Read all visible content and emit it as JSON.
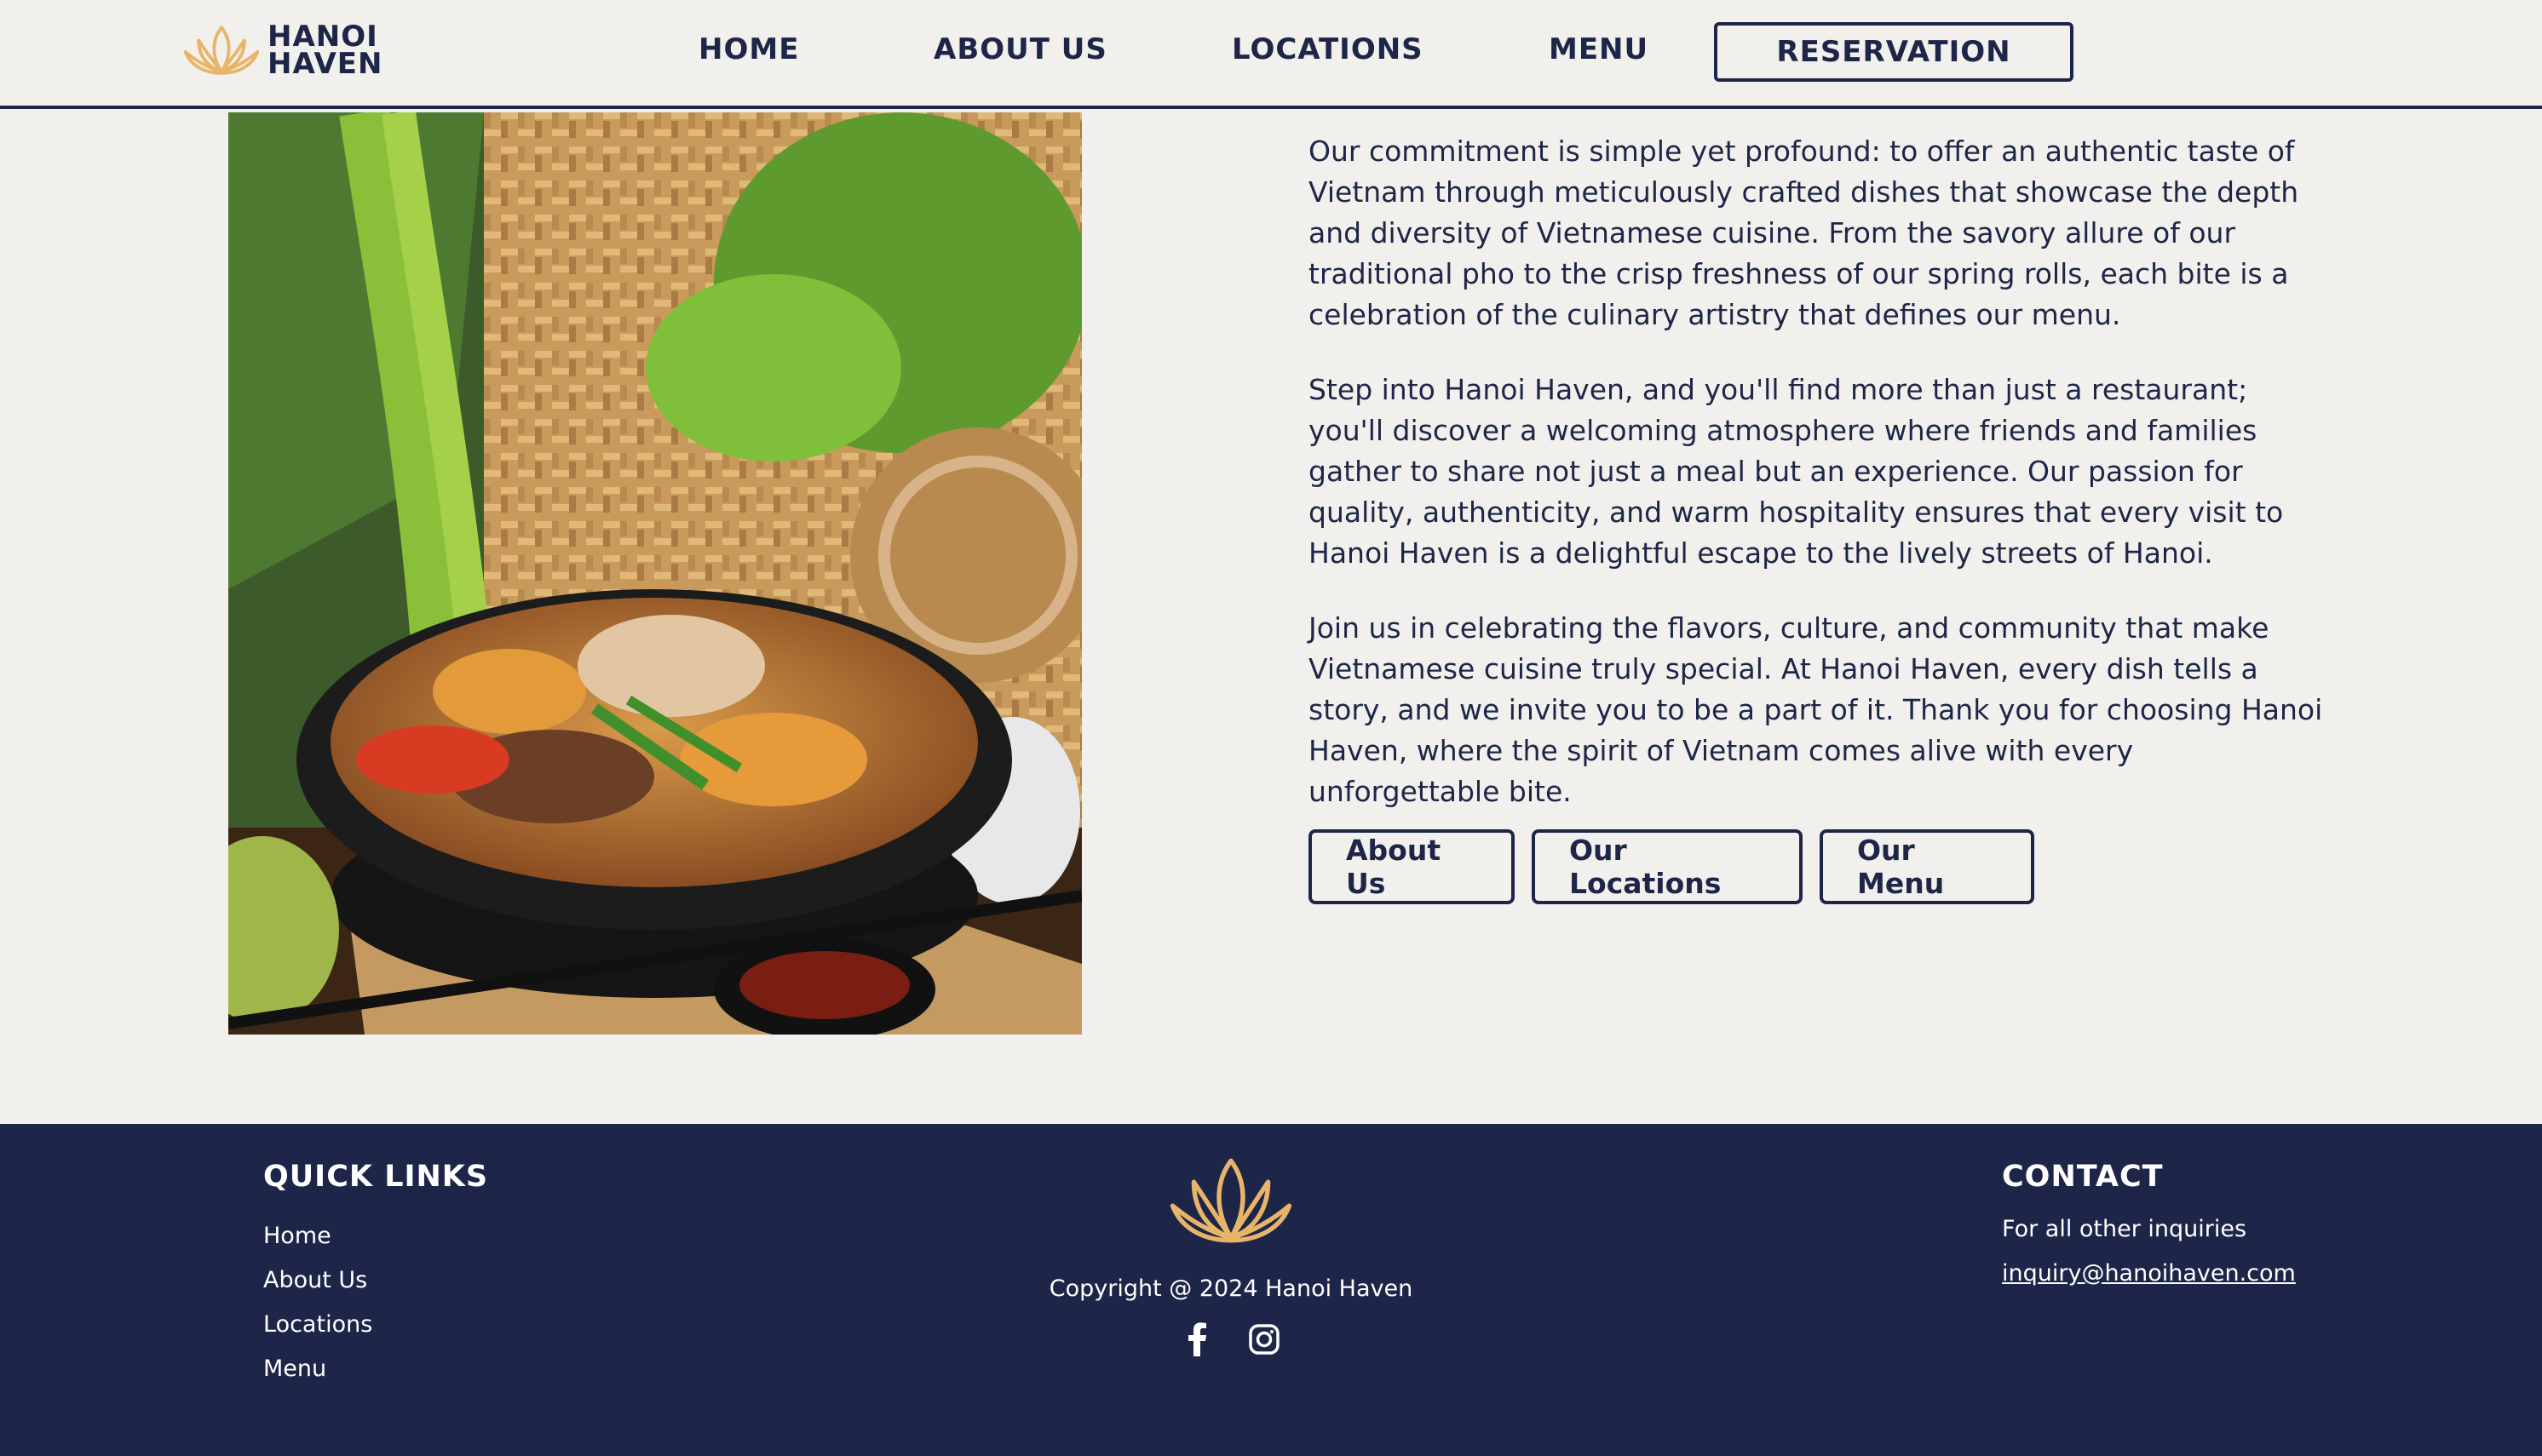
{
  "brand": {
    "name_line1": "HANOI",
    "name_line2": "HAVEN",
    "accent": "#e8b46a",
    "navy": "#1d2648"
  },
  "nav": {
    "items": [
      {
        "label": "HOME"
      },
      {
        "label": "ABOUT US"
      },
      {
        "label": "LOCATIONS"
      },
      {
        "label": "MENU"
      }
    ],
    "reservation_label": "RESERVATION"
  },
  "hero_image": {
    "icon": "food-photo"
  },
  "content": {
    "paragraphs": [
      "Our commitment is simple yet profound: to offer an authentic taste of Vietnam through meticulously crafted dishes that showcase the depth and diversity of Vietnamese cuisine. From the savory allure of our traditional pho to the crisp freshness of our spring rolls, each bite is a celebration of the culinary artistry that defines our menu.",
      "Step into Hanoi Haven, and you'll find more than just a restaurant; you'll discover a welcoming atmosphere where friends and families gather to share not just a meal but an experience. Our passion for quality, authenticity, and warm hospitality ensures that every visit to Hanoi Haven is a delightful escape to the lively streets of Hanoi.",
      "Join us in celebrating the flavors, culture, and community that make Vietnamese cuisine truly special. At Hanoi Haven, every dish tells a story, and we invite you to be a part of it. Thank you for choosing Hanoi Haven, where the spirit of Vietnam comes alive with every unforgettable bite."
    ],
    "buttons": [
      {
        "label": "About Us"
      },
      {
        "label": "Our Locations"
      },
      {
        "label": "Our Menu"
      }
    ]
  },
  "footer": {
    "quick_links_title": "QUICK LINKS",
    "quick_links": [
      "Home",
      "About Us",
      "Locations",
      "Menu"
    ],
    "copyright": "Copyright @ 2024 Hanoi Haven",
    "social_icons": [
      "facebook-icon",
      "instagram-icon"
    ],
    "contact_title": "CONTACT",
    "contact_text": "For all other inquiries",
    "contact_email": "inquiry@hanoihaven.com"
  }
}
